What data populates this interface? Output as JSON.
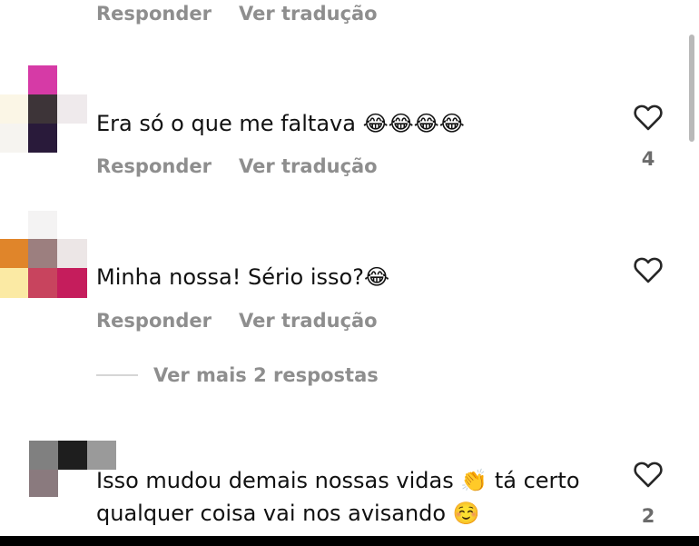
{
  "colors": {
    "text": "#111111",
    "secondary": "#8e8e8e",
    "scrollbar": "#b9b9b9"
  },
  "comments": [
    {
      "reply_label": "Responder",
      "translate_label": "Ver tradução"
    },
    {
      "text": "Era só o que me faltava 😂😂😂😂",
      "reply_label": "Responder",
      "translate_label": "Ver tradução",
      "like_count": "4",
      "like_icon": "heart-outline-icon"
    },
    {
      "text": "Minha nossa! Sério isso?😂",
      "reply_label": "Responder",
      "translate_label": "Ver tradução",
      "like_icon": "heart-outline-icon",
      "view_more_label": "Ver mais 2 respostas"
    },
    {
      "text": "Isso mudou demais nossas vidas 👏 tá certo qualquer coisa vai nos avisando ☺️",
      "like_count": "2",
      "like_icon": "heart-outline-icon"
    }
  ]
}
